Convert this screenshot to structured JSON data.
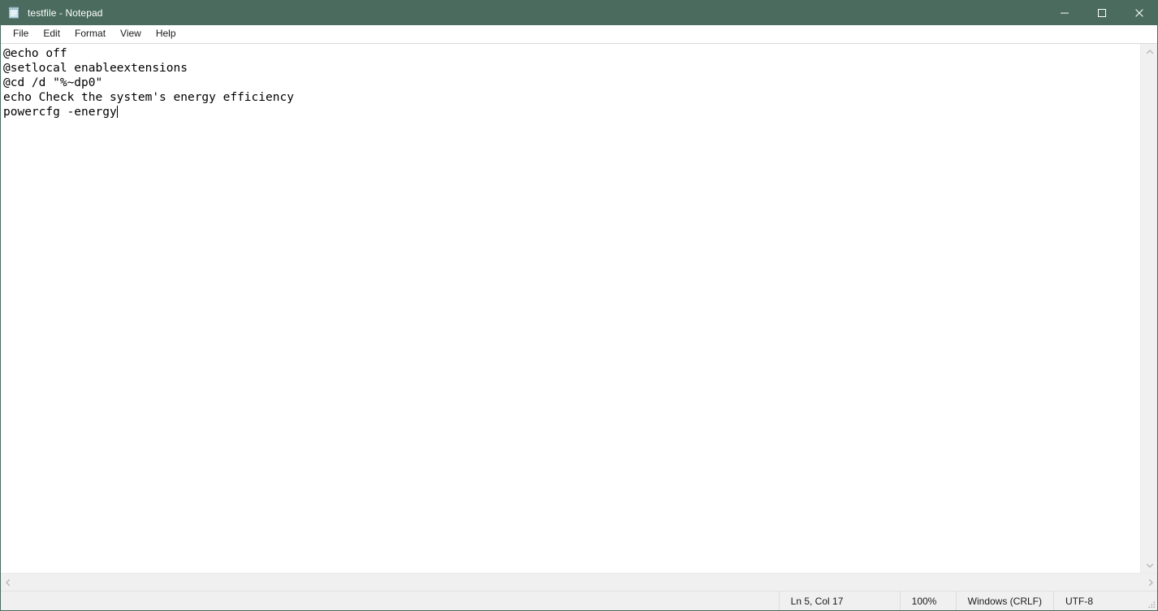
{
  "window": {
    "title": "testfile - Notepad",
    "icon": "notepad-icon",
    "titlebar_color": "#4a6b5e",
    "controls": {
      "minimize": "minimize-icon",
      "maximize": "maximize-icon",
      "close": "close-icon"
    }
  },
  "menubar": {
    "items": [
      {
        "label": "File"
      },
      {
        "label": "Edit"
      },
      {
        "label": "Format"
      },
      {
        "label": "View"
      },
      {
        "label": "Help"
      }
    ]
  },
  "editor": {
    "content": "@echo off\n@setlocal enableextensions\n@cd /d \"%~dp0\"\necho Check the system's energy efficiency\npowercfg -energy",
    "lines": [
      "@echo off",
      "@setlocal enableextensions",
      "@cd /d \"%~dp0\"",
      "echo Check the system's energy efficiency",
      "powercfg -energy"
    ],
    "text_color": "#000000",
    "background_color": "#ffffff"
  },
  "scrollbars": {
    "vertical": {
      "up_arrow": "chevron-up-icon",
      "down_arrow": "chevron-down-icon"
    },
    "horizontal": {
      "left_arrow": "chevron-left-icon",
      "right_arrow": "chevron-right-icon"
    }
  },
  "statusbar": {
    "position": "Ln 5, Col 17",
    "zoom": "100%",
    "line_ending": "Windows (CRLF)",
    "encoding": "UTF-8",
    "grip": "resize-grip-icon"
  }
}
